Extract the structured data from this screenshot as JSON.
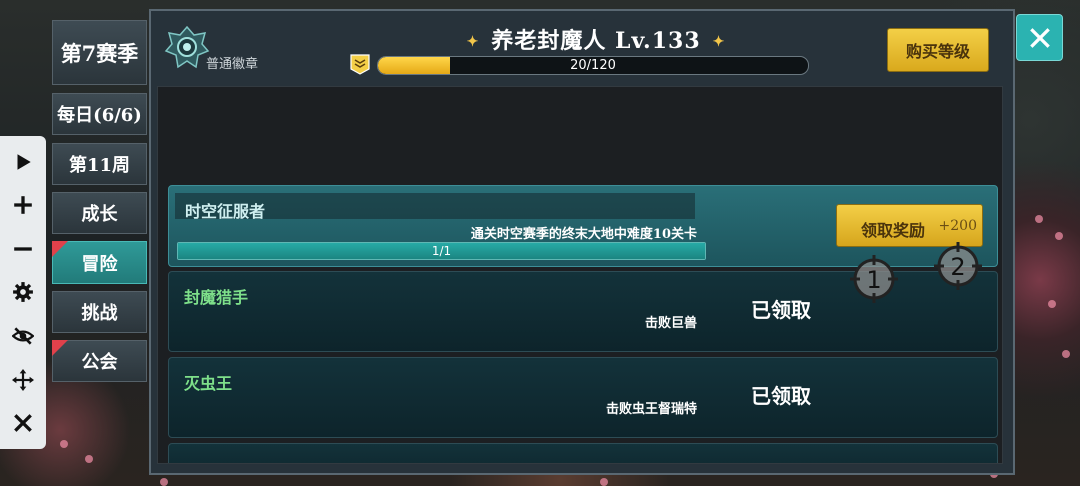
{
  "toolbar": {
    "icons": [
      "play-icon",
      "plus-icon",
      "minus-icon",
      "gear-icon",
      "eye-slash-icon",
      "move-icon",
      "close-icon"
    ]
  },
  "tabs": [
    {
      "label": "第7赛季"
    },
    {
      "label": "每日(6/6)"
    },
    {
      "label": "第11周"
    },
    {
      "label": "成长"
    },
    {
      "label": "冒险",
      "active": true,
      "alert": true
    },
    {
      "label": "挑战"
    },
    {
      "label": "公会",
      "alert": true
    }
  ],
  "header": {
    "badge_label": "普通徽章",
    "title": "养老封魔人 Lv.133",
    "xp_text": "20/120",
    "xp_fraction": 0.1667,
    "buy_label": "购买等级"
  },
  "tasks": [
    {
      "name": "时空征服者",
      "desc": "通关时空赛季的终末大地中难度10关卡",
      "progress_text": "1/1",
      "progress_fraction": 1.0,
      "claim_label": "领取奖励",
      "bonus": "+200"
    },
    {
      "name": "封魔猎手",
      "desc": "击败巨兽",
      "status": "已领取"
    },
    {
      "name": "灭虫王",
      "desc": "击败虫王督瑞特",
      "status": "已领取"
    }
  ],
  "markers": [
    "1",
    "2"
  ],
  "colors": {
    "accent": "#2bb3b1",
    "gold": "#f3cf47",
    "task_name": "#7ee08a"
  }
}
